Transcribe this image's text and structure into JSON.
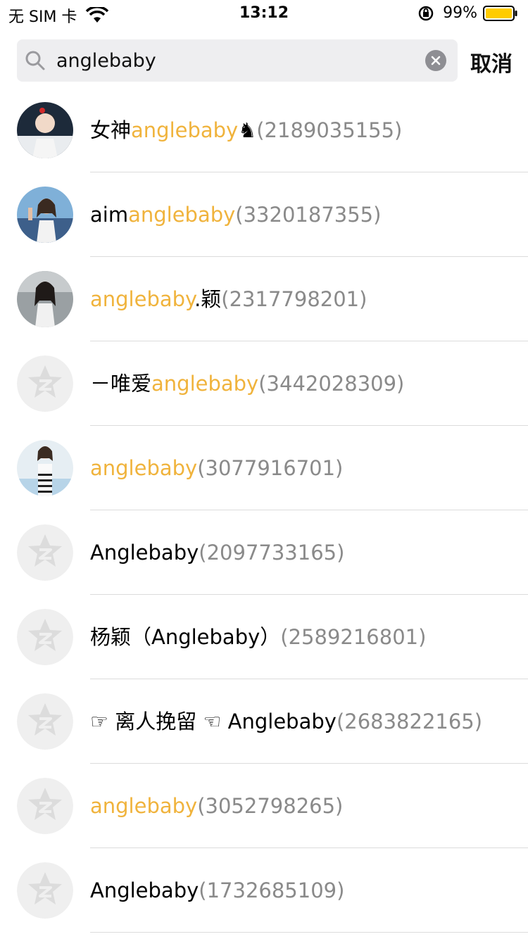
{
  "status_bar": {
    "carrier": "无 SIM 卡",
    "time": "13:12",
    "battery": "99%"
  },
  "search": {
    "value": "anglebaby",
    "cancel_label": "取消"
  },
  "results": [
    {
      "pre": "女神",
      "hl": "anglebaby",
      "post": "♞",
      "num": "(2189035155)",
      "avatar": "photo-boy"
    },
    {
      "pre": "aim",
      "hl": "anglebaby",
      "post": "",
      "num": "(3320187355)",
      "avatar": "photo-girl-beach"
    },
    {
      "pre": "",
      "hl": "anglebaby",
      "post": ".颖",
      "num": "(2317798201)",
      "avatar": "photo-girl-grey"
    },
    {
      "pre": "－唯爱",
      "hl": "anglebaby",
      "post": "",
      "num": "(3442028309)",
      "avatar": "default-qq"
    },
    {
      "pre": "",
      "hl": "anglebaby",
      "post": "",
      "num": "(3077916701)",
      "avatar": "photo-girl-stripes"
    },
    {
      "pre": "Anglebaby",
      "hl": "",
      "post": "",
      "num": "(2097733165)",
      "avatar": "default-qq"
    },
    {
      "pre": "杨颖（Anglebaby）",
      "hl": "",
      "post": "",
      "num": "(2589216801)",
      "avatar": "default-qq"
    },
    {
      "pre": "☞ 离人挽留 ☜ Anglebaby",
      "hl": "",
      "post": "",
      "num": "(2683822165)",
      "avatar": "default-qq"
    },
    {
      "pre": "",
      "hl": "anglebaby",
      "post": "",
      "num": "(3052798265)",
      "avatar": "default-qq"
    },
    {
      "pre": "Anglebaby",
      "hl": "",
      "post": "",
      "num": "(1732685109)",
      "avatar": "default-qq"
    }
  ],
  "colors": {
    "highlight": "#f0b33c",
    "number": "#8a8a8a",
    "search_bg": "#eeeef0",
    "battery": "#ffcc00"
  }
}
